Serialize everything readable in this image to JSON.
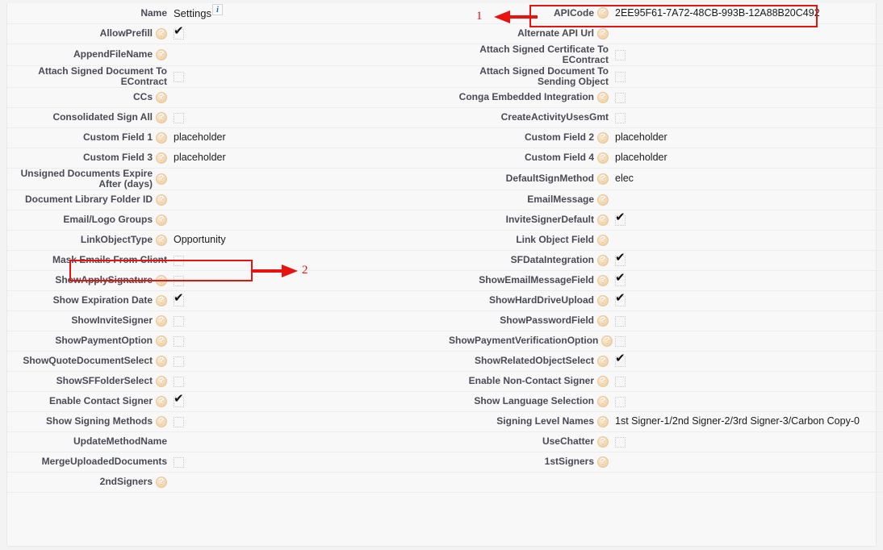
{
  "panel": {
    "name_field_label": "Name",
    "name_field_value": "Settings",
    "info_icon": "info-icon"
  },
  "rows": [
    {
      "left": {
        "label": "Name",
        "help": false,
        "type": "name",
        "value": "Settings"
      },
      "right": {
        "label": "APICode",
        "help": true,
        "type": "text",
        "value": "2EE95F61-7A72-48CB-993B-12A88B20C492"
      }
    },
    {
      "left": {
        "label": "AllowPrefill",
        "help": true,
        "type": "checkbox",
        "checked": true
      },
      "right": {
        "label": "Alternate API Url",
        "help": true,
        "type": "text",
        "value": ""
      }
    },
    {
      "left": {
        "label": "AppendFileName",
        "help": true,
        "type": "text",
        "value": ""
      },
      "right": {
        "label": "Attach Signed Certificate To EContract",
        "help": false,
        "type": "checkbox",
        "checked": false
      }
    },
    {
      "left": {
        "label": "Attach Signed Document To EContract",
        "help": false,
        "type": "checkbox",
        "checked": false
      },
      "right": {
        "label": "Attach Signed Document To Sending Object",
        "help": false,
        "type": "checkbox",
        "checked": false
      }
    },
    {
      "left": {
        "label": "CCs",
        "help": true,
        "type": "text",
        "value": ""
      },
      "right": {
        "label": "Conga Embedded Integration",
        "help": true,
        "type": "checkbox",
        "checked": false
      }
    },
    {
      "left": {
        "label": "Consolidated Sign All",
        "help": true,
        "type": "checkbox",
        "checked": false
      },
      "right": {
        "label": "CreateActivityUsesGmt",
        "help": false,
        "type": "checkbox",
        "checked": false
      }
    },
    {
      "left": {
        "label": "Custom Field 1",
        "help": true,
        "type": "text",
        "value": "placeholder"
      },
      "right": {
        "label": "Custom Field 2",
        "help": true,
        "type": "text",
        "value": "placeholder"
      }
    },
    {
      "left": {
        "label": "Custom Field 3",
        "help": true,
        "type": "text",
        "value": "placeholder"
      },
      "right": {
        "label": "Custom Field 4",
        "help": true,
        "type": "text",
        "value": "placeholder"
      }
    },
    {
      "left": {
        "label": "Unsigned Documents Expire After (days)",
        "help": true,
        "type": "text",
        "value": ""
      },
      "right": {
        "label": "DefaultSignMethod",
        "help": true,
        "type": "text",
        "value": "elec"
      }
    },
    {
      "left": {
        "label": "Document Library Folder ID",
        "help": true,
        "type": "text",
        "value": ""
      },
      "right": {
        "label": "EmailMessage",
        "help": true,
        "type": "text",
        "value": ""
      }
    },
    {
      "left": {
        "label": "Email/Logo Groups",
        "help": true,
        "type": "text",
        "value": ""
      },
      "right": {
        "label": "InviteSignerDefault",
        "help": true,
        "type": "checkbox",
        "checked": true
      }
    },
    {
      "left": {
        "label": "LinkObjectType",
        "help": true,
        "type": "text",
        "value": "Opportunity"
      },
      "right": {
        "label": "Link Object Field",
        "help": true,
        "type": "text",
        "value": ""
      }
    },
    {
      "left": {
        "label": "Mask Emails From Client",
        "help": false,
        "type": "checkbox",
        "checked": false
      },
      "right": {
        "label": "SFDataIntegration",
        "help": true,
        "type": "checkbox",
        "checked": true
      }
    },
    {
      "left": {
        "label": "ShowApplySignature",
        "help": true,
        "type": "checkbox",
        "checked": false
      },
      "right": {
        "label": "ShowEmailMessageField",
        "help": true,
        "type": "checkbox",
        "checked": true
      }
    },
    {
      "left": {
        "label": "Show Expiration Date",
        "help": true,
        "type": "checkbox",
        "checked": true
      },
      "right": {
        "label": "ShowHardDriveUpload",
        "help": true,
        "type": "checkbox",
        "checked": true
      }
    },
    {
      "left": {
        "label": "ShowInviteSigner",
        "help": true,
        "type": "checkbox",
        "checked": false
      },
      "right": {
        "label": "ShowPasswordField",
        "help": true,
        "type": "checkbox",
        "checked": false
      }
    },
    {
      "left": {
        "label": "ShowPaymentOption",
        "help": true,
        "type": "checkbox",
        "checked": false
      },
      "right": {
        "label": "ShowPaymentVerificationOption",
        "help": true,
        "type": "checkbox",
        "checked": false
      }
    },
    {
      "left": {
        "label": "ShowQuoteDocumentSelect",
        "help": true,
        "type": "checkbox",
        "checked": false
      },
      "right": {
        "label": "ShowRelatedObjectSelect",
        "help": true,
        "type": "checkbox",
        "checked": true
      }
    },
    {
      "left": {
        "label": "ShowSFFolderSelect",
        "help": true,
        "type": "checkbox",
        "checked": false
      },
      "right": {
        "label": "Enable Non-Contact Signer",
        "help": true,
        "type": "checkbox",
        "checked": false
      }
    },
    {
      "left": {
        "label": "Enable Contact Signer",
        "help": true,
        "type": "checkbox",
        "checked": true
      },
      "right": {
        "label": "Show Language Selection",
        "help": true,
        "type": "checkbox",
        "checked": false
      }
    },
    {
      "left": {
        "label": "Show Signing Methods",
        "help": true,
        "type": "checkbox",
        "checked": false
      },
      "right": {
        "label": "Signing Level Names",
        "help": true,
        "type": "text",
        "value": "1st Signer-1/2nd Signer-2/3rd Signer-3/Carbon Copy-0"
      }
    },
    {
      "left": {
        "label": "UpdateMethodName",
        "help": false,
        "type": "text",
        "value": ""
      },
      "right": {
        "label": "UseChatter",
        "help": true,
        "type": "checkbox",
        "checked": false
      }
    },
    {
      "left": {
        "label": "MergeUploadedDocuments",
        "help": false,
        "type": "checkbox",
        "checked": false
      },
      "right": {
        "label": "1stSigners",
        "help": true,
        "type": "text",
        "value": ""
      }
    },
    {
      "left": {
        "label": "2ndSigners",
        "help": true,
        "type": "text",
        "value": ""
      },
      "right": {
        "label": "",
        "help": false,
        "type": "empty",
        "value": ""
      }
    }
  ],
  "annotations": {
    "color": "#e8120e",
    "items": [
      {
        "number": "1",
        "target": "APICode",
        "direction": "left"
      },
      {
        "number": "2",
        "target": "LinkObjectType",
        "direction": "right"
      }
    ]
  }
}
